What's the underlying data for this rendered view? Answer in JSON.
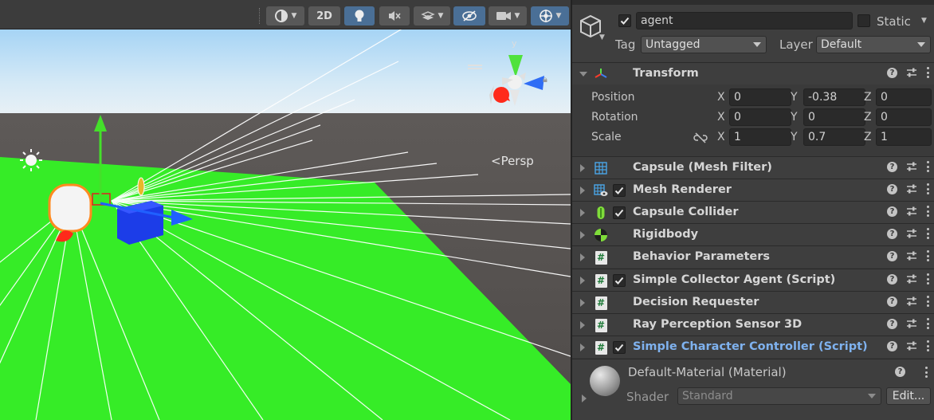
{
  "scene": {
    "toolbar": {
      "mode_2d": "2D"
    },
    "persp_label": "<Persp",
    "gizmo_axis_y": "y"
  },
  "inspector": {
    "object": {
      "active": true,
      "name": "agent",
      "static_label": "Static",
      "tag_label": "Tag",
      "tag_value": "Untagged",
      "layer_label": "Layer",
      "layer_value": "Default"
    },
    "transform": {
      "title": "Transform",
      "position": {
        "label": "Position",
        "x": "0",
        "y": "-0.38",
        "z": "0"
      },
      "rotation": {
        "label": "Rotation",
        "x": "0",
        "y": "0",
        "z": "0"
      },
      "scale": {
        "label": "Scale",
        "x": "1",
        "y": "0.7",
        "z": "1"
      },
      "axis_x": "X",
      "axis_y": "Y",
      "axis_z": "Z"
    },
    "components": [
      {
        "name": "Capsule (Mesh Filter)",
        "icon": "mesh-filter-icon",
        "checkbox": false
      },
      {
        "name": "Mesh Renderer",
        "icon": "mesh-renderer-icon",
        "checkbox": true
      },
      {
        "name": "Capsule Collider",
        "icon": "capsule-collider-icon",
        "checkbox": true
      },
      {
        "name": "Rigidbody",
        "icon": "rigidbody-icon",
        "checkbox": false
      },
      {
        "name": "Behavior Parameters",
        "icon": "script-icon",
        "checkbox": false
      },
      {
        "name": "Simple Collector Agent (Script)",
        "icon": "script-icon",
        "checkbox": true
      },
      {
        "name": "Decision Requester",
        "icon": "script-icon",
        "checkbox": false
      },
      {
        "name": "Ray Perception Sensor 3D",
        "icon": "script-icon",
        "checkbox": false
      },
      {
        "name": "Simple Character Controller (Script)",
        "icon": "script-icon",
        "checkbox": true,
        "highlight": true
      }
    ],
    "material": {
      "name": "Default-Material (Material)",
      "shader_label": "Shader",
      "shader_value": "Standard",
      "edit_label": "Edit..."
    },
    "colors": {
      "ground": "#38ea2a",
      "sky_top": "#a8d8f8",
      "highlight_text": "#7fb2ef"
    }
  }
}
